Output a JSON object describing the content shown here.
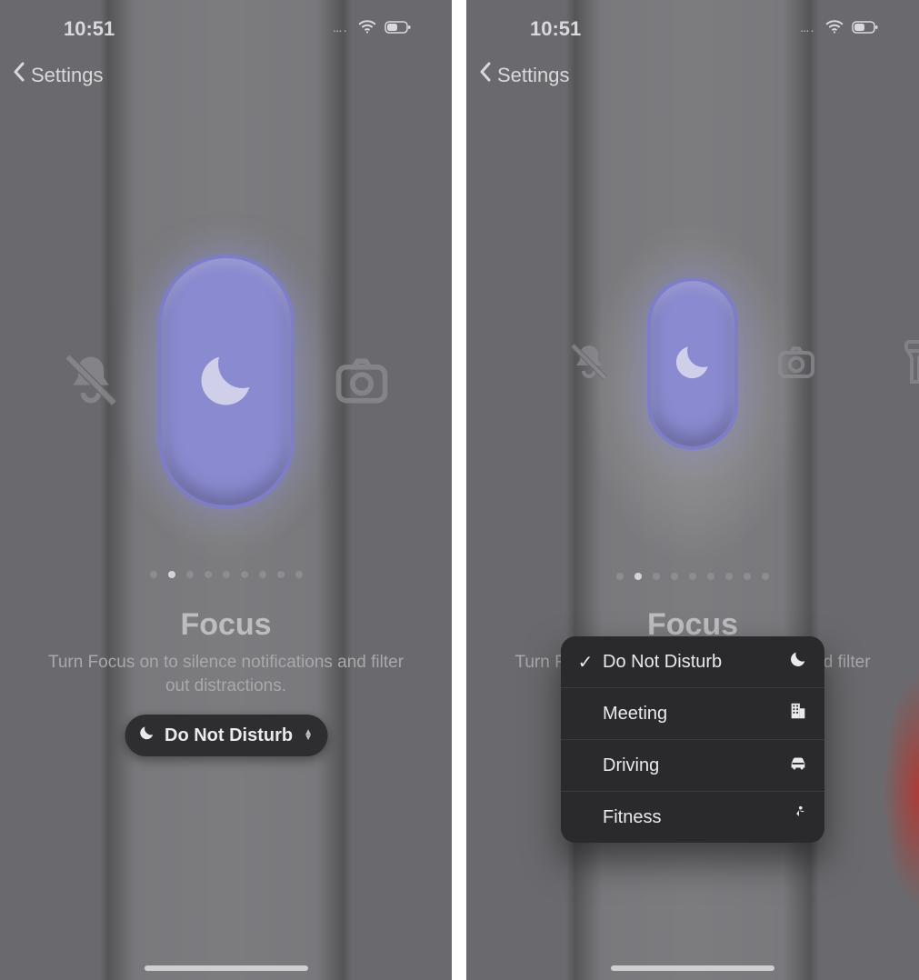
{
  "status": {
    "time": "10:51",
    "dots": "…."
  },
  "nav": {
    "back_label": "Settings"
  },
  "page": {
    "title": "Focus",
    "description": "Turn Focus on to silence notifications and filter out distractions.",
    "dot_count": 9,
    "active_dot_index": 1
  },
  "selector": {
    "selected_label": "Do Not Disturb"
  },
  "menu": {
    "items": [
      {
        "label": "Do Not Disturb",
        "icon": "moon",
        "checked": true
      },
      {
        "label": "Meeting",
        "icon": "building",
        "checked": false
      },
      {
        "label": "Driving",
        "icon": "car",
        "checked": false
      },
      {
        "label": "Fitness",
        "icon": "runner",
        "checked": false
      }
    ]
  }
}
